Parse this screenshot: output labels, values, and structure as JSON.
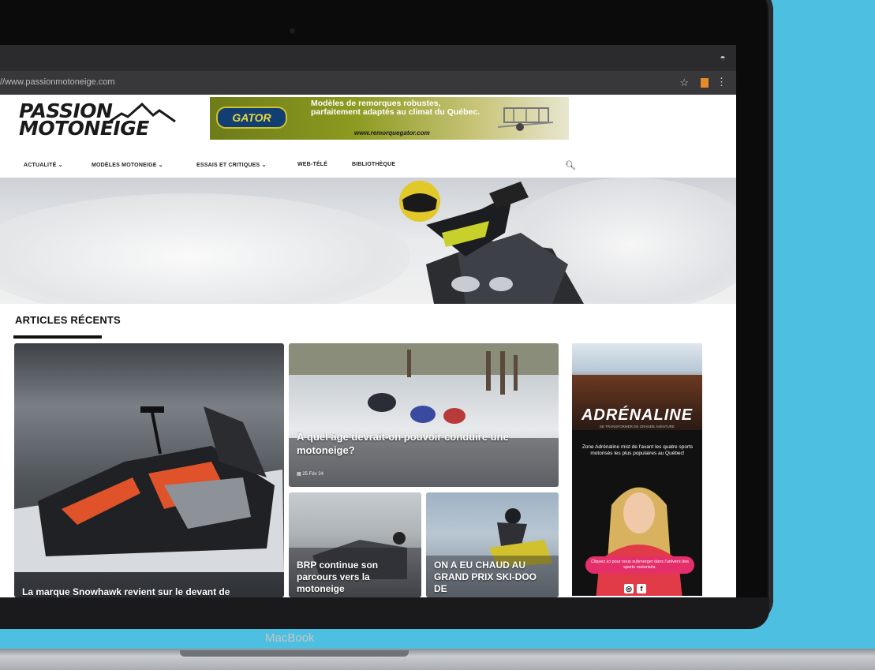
{
  "device": {
    "label": "MacBook"
  },
  "browser": {
    "url": "//www.passionmotoneige.com"
  },
  "site": {
    "logo_line1": "PASSION",
    "logo_line2": "MOTONEIGE",
    "banner": {
      "brand": "GATOR",
      "text": "Modèles de remorques robustes, parfaitement adaptés au climat du Québec.",
      "url": "www.remorquegator.com"
    },
    "nav": [
      {
        "label": "ACTUALITÉ",
        "caret": "⌄"
      },
      {
        "label": "MODÈLES MOTONEIGE",
        "caret": "⌄"
      },
      {
        "label": "ESSAIS ET CRITIQUES",
        "caret": "⌄"
      },
      {
        "label": "WEB-TÉLÉ",
        "caret": ""
      },
      {
        "label": "BIBLIOTHÈQUE",
        "caret": ""
      }
    ]
  },
  "section": {
    "title": "ARTICLES RÉCENTS"
  },
  "articles": [
    {
      "title": "La marque Snowhawk revient sur le devant de"
    },
    {
      "title": "À quel âge devrait-on pouvoir conduire une motoneige?",
      "date": "▦ 25 Fév 24"
    },
    {
      "title": "BRP continue son parcours vers la motoneige"
    },
    {
      "title": "ON A EU CHAUD AU GRAND PRIX SKI-DOO DE"
    }
  ],
  "ad": {
    "logo": "ADRÉNALINE",
    "tagline": "SE TRANSFORMER EN GRANDE AVENTURE",
    "text": "Zone Adrénaline mist de l'avant les quatre sports motorisés les plus populaires au Québec!",
    "button": "Cliquez ici pour vous submerger dans l'univers des sports motorisés.",
    "social": [
      "◎",
      "f"
    ]
  },
  "colors": {
    "background": "#4dbfe0",
    "accent": "#e52f6b"
  }
}
